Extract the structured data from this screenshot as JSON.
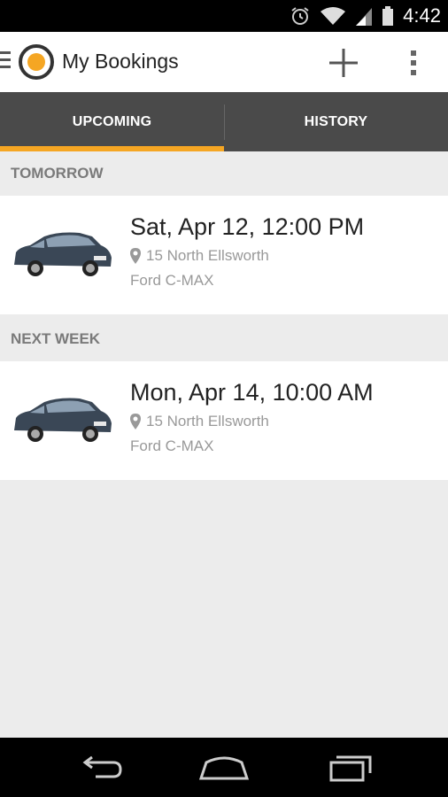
{
  "status_bar": {
    "time": "4:42",
    "icons": [
      "alarm-icon",
      "wifi-icon",
      "signal-icon",
      "battery-icon"
    ]
  },
  "app_bar": {
    "title": "My Bookings",
    "actions": [
      "add-icon",
      "overflow-menu-icon"
    ]
  },
  "tabs": [
    {
      "label": "UPCOMING",
      "selected": true
    },
    {
      "label": "HISTORY",
      "selected": false
    }
  ],
  "sections": [
    {
      "header": "TOMORROW",
      "bookings": [
        {
          "date": "Sat, Apr 12, 12:00 PM",
          "location": "15 North Ellsworth",
          "car": "Ford C-MAX"
        }
      ]
    },
    {
      "header": "NEXT WEEK",
      "bookings": [
        {
          "date": "Mon, Apr 14, 10:00 AM",
          "location": "15 North Ellsworth",
          "car": "Ford C-MAX"
        }
      ]
    }
  ],
  "nav_bar": {
    "buttons": [
      "back-icon",
      "home-icon",
      "recents-icon"
    ]
  },
  "colors": {
    "accent": "#f5a623",
    "tab_bar": "#4a4a4a",
    "background": "#ececec"
  }
}
